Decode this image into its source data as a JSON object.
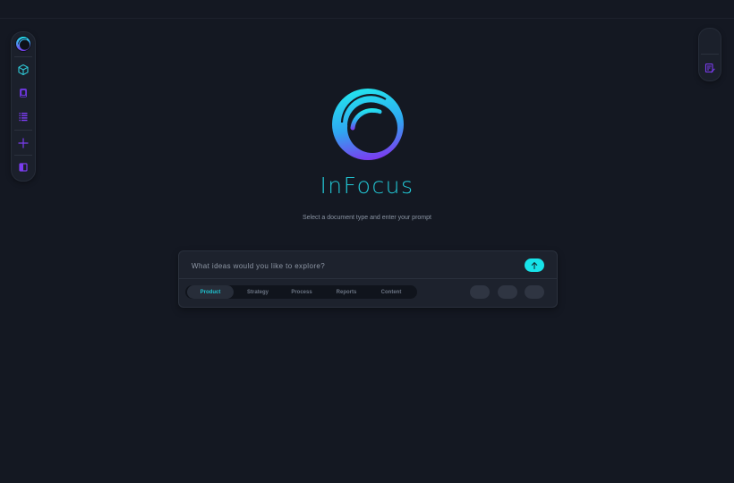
{
  "brand": {
    "title": "InFocus",
    "subtitle": "Select a document type and enter your prompt"
  },
  "left_rail": {
    "items": [
      {
        "name": "logo-icon"
      },
      {
        "name": "cube-icon"
      },
      {
        "name": "book-icon"
      },
      {
        "name": "list-icon"
      },
      {
        "name": "plus-icon"
      },
      {
        "name": "sidebar-panel-icon"
      }
    ]
  },
  "right_rail": {
    "items": [
      {
        "name": "blank-slot"
      },
      {
        "name": "edit-document-icon"
      }
    ]
  },
  "prompt": {
    "placeholder": "What ideas would you like to explore?",
    "value": "",
    "send_icon": "arrow-up-icon"
  },
  "tabs": [
    {
      "label": "Product",
      "active": true
    },
    {
      "label": "Strategy",
      "active": false
    },
    {
      "label": "Process",
      "active": false
    },
    {
      "label": "Reports",
      "active": false
    },
    {
      "label": "Content",
      "active": false
    }
  ],
  "colors": {
    "background": "#141822",
    "accent_cyan": "#22c6d4",
    "accent_purple": "#7b3cf0",
    "send_button": "#18e3e9"
  }
}
